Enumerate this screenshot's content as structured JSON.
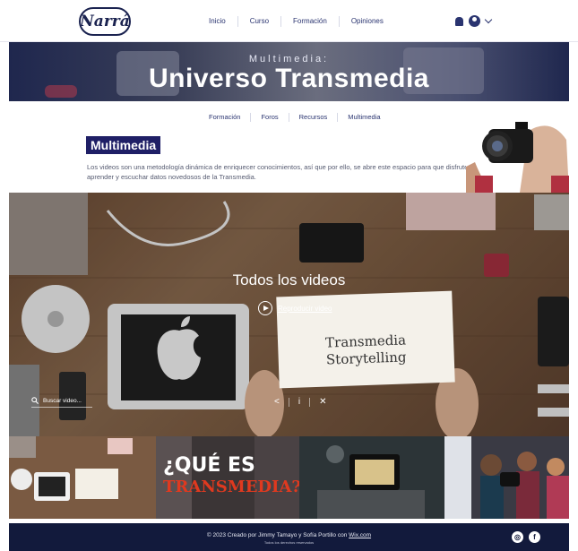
{
  "header": {
    "logo_text": "Narrá",
    "nav": [
      "Inicio",
      "Curso",
      "Formación",
      "Opiniones"
    ],
    "icons": [
      "bell-icon",
      "user-icon",
      "chevron-down-icon"
    ]
  },
  "hero": {
    "subtitle": "Multimedia:",
    "title": "Universo Transmedia"
  },
  "subnav": [
    "Formación",
    "Foros",
    "Recursos",
    "Multimedia"
  ],
  "section": {
    "label": "Multimedia",
    "description": "Los videos son una metodología dinámica de enriquecer conocimientos, así que por ello, se abre este espacio para que disfrutes aprender y escuchar datos novedosos de la Transmedia."
  },
  "video": {
    "title": "Todos los videos",
    "play_label": "Reproducir video",
    "search_placeholder": "Buscar video...",
    "card_text_1": "Transmedia",
    "card_text_2": "Storytelling",
    "controls": [
      "share-icon",
      "info-icon",
      "close-icon"
    ]
  },
  "thumbnails": {
    "t2_line1": "¿QUÉ ES",
    "t2_line2": "TRANSMEDIA?"
  },
  "footer": {
    "credit": "© 2023 Creado por Jimmy Tamayo y Sofía Portillo con",
    "credit_link": "Wix.com",
    "rights": "Todos los derechos reservados",
    "social": [
      "instagram-icon",
      "facebook-icon"
    ]
  },
  "colors": {
    "navy": "#1b2350",
    "accent_label": "#1f1f66",
    "footer_bg": "#121a3c",
    "link": "#2a3470"
  }
}
